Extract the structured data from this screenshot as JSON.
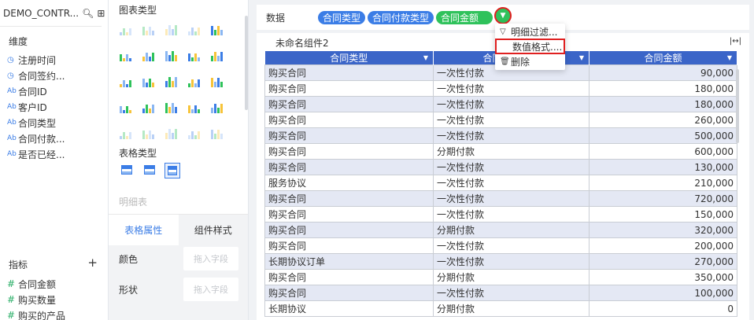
{
  "left": {
    "title": "DEMO_CONTR...",
    "search_icon": "search-icon",
    "grid_icon": "grid-icon",
    "dimension_label": "维度",
    "dimensions": [
      {
        "prefix": "◷",
        "type": "date",
        "label": "注册时间"
      },
      {
        "prefix": "◷",
        "type": "date",
        "label": "合同签约..."
      },
      {
        "prefix": "Ab",
        "type": "text",
        "label": "合同ID"
      },
      {
        "prefix": "Ab",
        "type": "text",
        "label": "客户ID"
      },
      {
        "prefix": "Ab",
        "type": "text",
        "label": "合同类型"
      },
      {
        "prefix": "Ab",
        "type": "text",
        "label": "合同付款..."
      },
      {
        "prefix": "Ab",
        "type": "text",
        "label": "是否已经..."
      }
    ],
    "measure_label": "指标",
    "add_label": "+",
    "measures": [
      {
        "prefix": "#",
        "label": "合同金额"
      },
      {
        "prefix": "#",
        "label": "购买数量"
      },
      {
        "prefix": "#",
        "label": "购买的产品"
      }
    ]
  },
  "middle": {
    "chart_type_label": "图表类型",
    "table_type_label": "表格类型",
    "detail_table_label": "明细表",
    "tabs": [
      {
        "label": "表格属性"
      },
      {
        "label": "组件样式"
      }
    ],
    "properties": [
      {
        "label": "颜色",
        "placeholder": "拖入字段"
      },
      {
        "label": "形状",
        "placeholder": "拖入字段"
      }
    ]
  },
  "right": {
    "data_label": "数据",
    "pills": [
      {
        "label": "合同类型",
        "color": "#3b7de6"
      },
      {
        "label": "合同付款类型",
        "color": "#3b7de6"
      },
      {
        "label": "合同金额",
        "color": "#2fc25b"
      }
    ],
    "component_title": "未命名组件2",
    "expand_icon": "expand-icon",
    "menu": [
      {
        "icon": "filter-icon",
        "label": "明细过滤..."
      },
      {
        "icon": "format-icon",
        "label": "数值格式...."
      },
      {
        "icon": "trash-icon",
        "label": "删除"
      }
    ],
    "table": {
      "headers": [
        "合同类型",
        "合同付款类型",
        "合同金额"
      ],
      "rows": [
        [
          "购买合同",
          "一次性付款",
          "90,000"
        ],
        [
          "购买合同",
          "一次性付款",
          "180,000"
        ],
        [
          "购买合同",
          "一次性付款",
          "180,000"
        ],
        [
          "购买合同",
          "一次性付款",
          "260,000"
        ],
        [
          "购买合同",
          "一次性付款",
          "500,000"
        ],
        [
          "购买合同",
          "分期付款",
          "600,000"
        ],
        [
          "购买合同",
          "一次性付款",
          "130,000"
        ],
        [
          "服务协议",
          "一次性付款",
          "210,000"
        ],
        [
          "购买合同",
          "一次性付款",
          "720,000"
        ],
        [
          "购买合同",
          "一次性付款",
          "150,000"
        ],
        [
          "购买合同",
          "分期付款",
          "320,000"
        ],
        [
          "购买合同",
          "一次性付款",
          "200,000"
        ],
        [
          "长期协议订单",
          "一次性付款",
          "270,000"
        ],
        [
          "购买合同",
          "分期付款",
          "350,000"
        ],
        [
          "购买合同",
          "一次性付款",
          "100,000"
        ],
        [
          "长期协议",
          "分期付款",
          "0"
        ]
      ]
    }
  }
}
